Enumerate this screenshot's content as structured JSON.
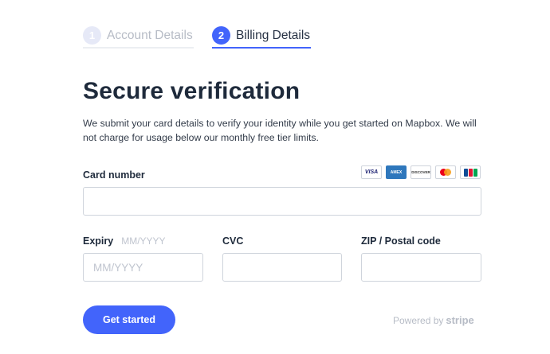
{
  "steps": [
    {
      "number": "1",
      "label": "Account Details",
      "active": false
    },
    {
      "number": "2",
      "label": "Billing Details",
      "active": true
    }
  ],
  "heading": "Secure verification",
  "description": "We submit your card details to verify your identity while you get started on Mapbox. We will not charge for usage below our monthly free tier limits.",
  "card_number": {
    "label": "Card number",
    "value": "",
    "placeholder": ""
  },
  "card_brands": [
    "VISA",
    "AMEX",
    "DISCOVER",
    "mastercard-icon",
    "JCB"
  ],
  "expiry": {
    "label": "Expiry",
    "hint": "MM/YYYY",
    "value": "",
    "placeholder": "MM/YYYY"
  },
  "cvc": {
    "label": "CVC",
    "value": "",
    "placeholder": ""
  },
  "zip": {
    "label": "ZIP / Postal code",
    "value": "",
    "placeholder": ""
  },
  "submit_label": "Get started",
  "powered_by": {
    "prefix": "Powered by",
    "brand": "stripe"
  },
  "colors": {
    "accent": "#4264fb",
    "heading": "#1e2a3b",
    "muted": "#b7bcc6"
  }
}
